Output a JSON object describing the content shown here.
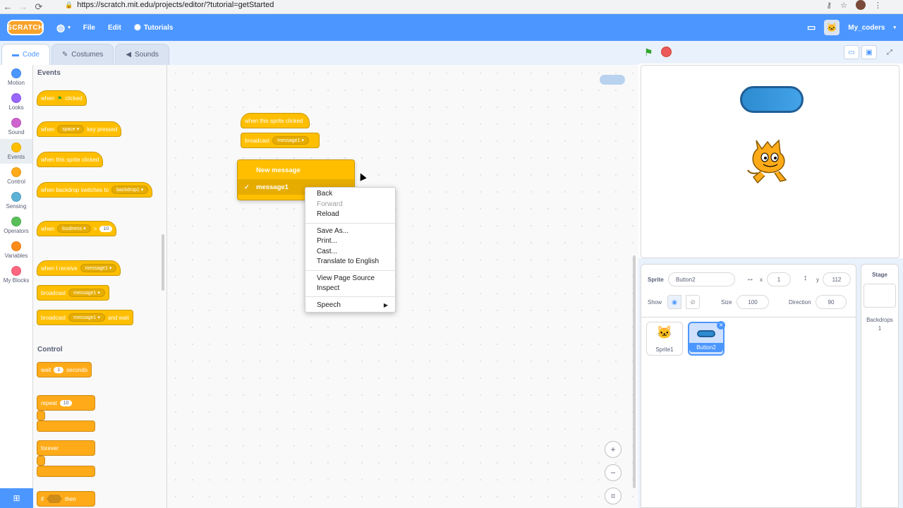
{
  "browser": {
    "url": "https://scratch.mit.edu/projects/editor/?tutorial=getStarted",
    "back": "←",
    "forward": "→",
    "reload": "⟳"
  },
  "menubar": {
    "logo": "SCRATCH",
    "language_icon": "globe-icon",
    "file": "File",
    "edit": "Edit",
    "tutorials": "Tutorials",
    "username": "My_coders"
  },
  "tabs": [
    {
      "label": "Code"
    },
    {
      "label": "Costumes"
    },
    {
      "label": "Sounds"
    }
  ],
  "categories": [
    {
      "label": "Motion",
      "color": "#4c97ff"
    },
    {
      "label": "Looks",
      "color": "#9966ff"
    },
    {
      "label": "Sound",
      "color": "#cf63cf"
    },
    {
      "label": "Events",
      "color": "#ffbf00"
    },
    {
      "label": "Control",
      "color": "#ffab19"
    },
    {
      "label": "Sensing",
      "color": "#5cb1d6"
    },
    {
      "label": "Operators",
      "color": "#59c059"
    },
    {
      "label": "Variables",
      "color": "#ff8c1a"
    },
    {
      "label": "My Blocks",
      "color": "#ff6680"
    }
  ],
  "palette": {
    "events_heading": "Events",
    "control_heading": "Control",
    "when": "when",
    "clicked": "clicked",
    "space": "space",
    "key_pressed": "key pressed",
    "when_sprite_clicked": "when this sprite clicked",
    "when_backdrop_switches": "when backdrop switches to",
    "backdrop1": "backdrop1",
    "loudness": "loudness",
    "gt": ">",
    "ten": "10",
    "when_i_receive": "when I receive",
    "message1": "message1",
    "broadcast": "broadcast",
    "and_wait": "and wait",
    "wait": "wait",
    "one": "1",
    "seconds": "seconds",
    "repeat": "repeat",
    "forever": "forever",
    "if": "if",
    "then": "then"
  },
  "script": {
    "hat": "when this sprite clicked",
    "broadcast": "broadcast",
    "message": "message1",
    "dropdown": {
      "new_message": "New message",
      "selected": "message1",
      "check": "✓"
    }
  },
  "context_menu": {
    "items": [
      "Back",
      "Forward",
      "Reload",
      "Save As...",
      "Print...",
      "Cast...",
      "Translate to English",
      "View Page Source",
      "Inspect",
      "Speech"
    ],
    "disabled": [
      "Forward"
    ]
  },
  "zoom": {
    "in": "+",
    "out": "−",
    "reset": "="
  },
  "sprite_info": {
    "sprite_label": "Sprite",
    "sprite_name": "Button2",
    "x_label": "x",
    "x_value": "1",
    "y_label": "y",
    "y_value": "112",
    "show_label": "Show",
    "size_label": "Size",
    "size_value": "100",
    "direction_label": "Direction",
    "direction_value": "90"
  },
  "sprites": [
    {
      "name": "Sprite1",
      "selected": false
    },
    {
      "name": "Button2",
      "selected": true
    }
  ],
  "stage_panel": {
    "title": "Stage",
    "backdrops_label": "Backdrops",
    "backdrops_count": "1"
  }
}
